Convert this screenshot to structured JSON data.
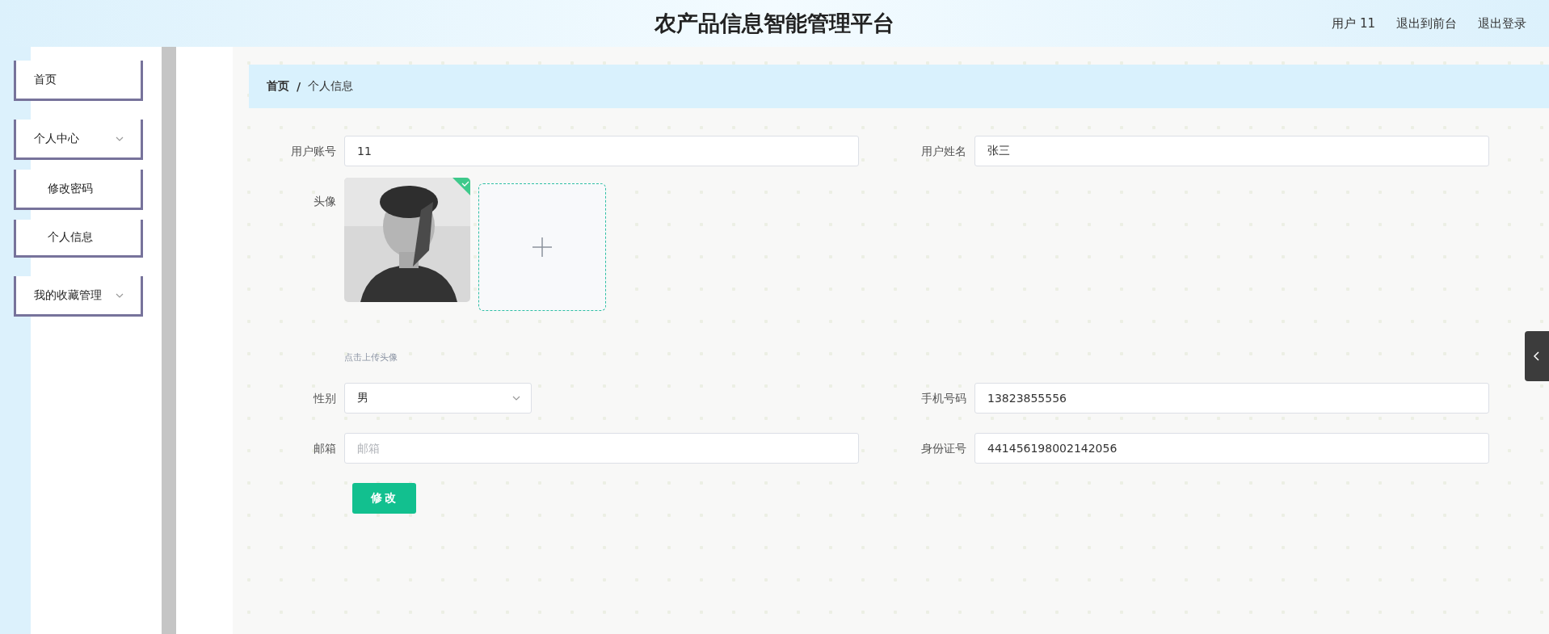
{
  "header": {
    "title": "农产品信息智能管理平台",
    "links": [
      "用户 11",
      "退出到前台",
      "退出登录"
    ]
  },
  "sidebar": {
    "items": [
      {
        "label": "首页",
        "kind": "link"
      },
      {
        "label": "个人中心",
        "kind": "menu",
        "children": [
          {
            "label": "修改密码"
          },
          {
            "label": "个人信息"
          }
        ]
      },
      {
        "label": "我的收藏管理",
        "kind": "menu"
      }
    ]
  },
  "breadcrumb": {
    "items": [
      "首页",
      "个人信息"
    ],
    "separator": "/"
  },
  "form": {
    "rows": [
      [
        {
          "label": "用户账号",
          "kind": "text",
          "value": "11"
        },
        {
          "label": "用户姓名",
          "kind": "text",
          "value": "张三"
        }
      ],
      [
        {
          "label": "头像",
          "kind": "avatar",
          "uploaded": true,
          "hint": "点击上传头像"
        }
      ],
      [
        {
          "label": "性别",
          "kind": "select",
          "value": "男"
        },
        {
          "label": "手机号码",
          "kind": "text",
          "value": "13823855556"
        }
      ],
      [
        {
          "label": "邮箱",
          "kind": "text",
          "placeholder": "邮箱"
        },
        {
          "label": "身份证号",
          "kind": "text",
          "value": "441456198002142056"
        }
      ]
    ],
    "submit": "修改"
  }
}
